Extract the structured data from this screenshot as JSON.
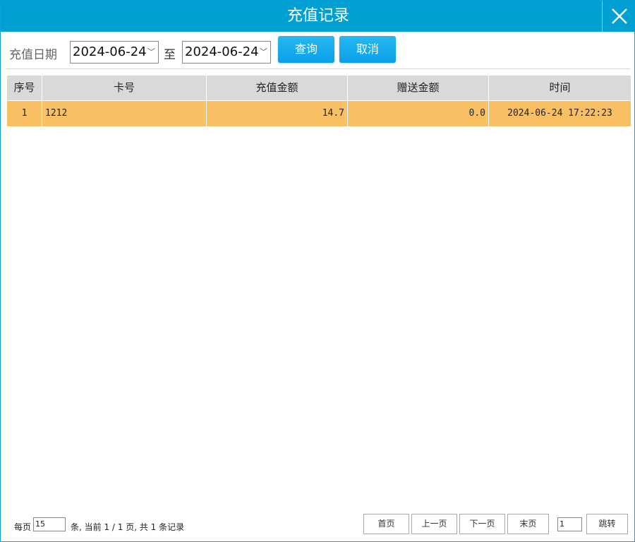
{
  "window": {
    "title": "充值记录"
  },
  "filter": {
    "date_label": "充值日期",
    "start_date": "2024-06-24",
    "to_label": "至",
    "end_date": "2024-06-24",
    "query_label": "查询",
    "cancel_label": "取消"
  },
  "table": {
    "headers": [
      "序号",
      "卡号",
      "充值金额",
      "赠送金额",
      "时间"
    ],
    "rows": [
      [
        "1",
        "1212",
        "14.7",
        "0.0",
        "2024-06-24 17:22:23"
      ]
    ],
    "highlight_color": "#f8c063"
  },
  "pager": {
    "per_page_label": "每页",
    "per_page_value": "15",
    "info_text": "条, 当前 1 / 1 页, 共 1 条记录",
    "first_label": "首页",
    "prev_label": "上一页",
    "next_label": "下一页",
    "last_label": "末页",
    "jump_value": "1",
    "jump_label": "跳转"
  },
  "colors": {
    "accent": "#00a0d2",
    "button": "#18aef0"
  },
  "icons": {
    "close": "close-icon",
    "dropdown": "chevron-down-icon"
  }
}
